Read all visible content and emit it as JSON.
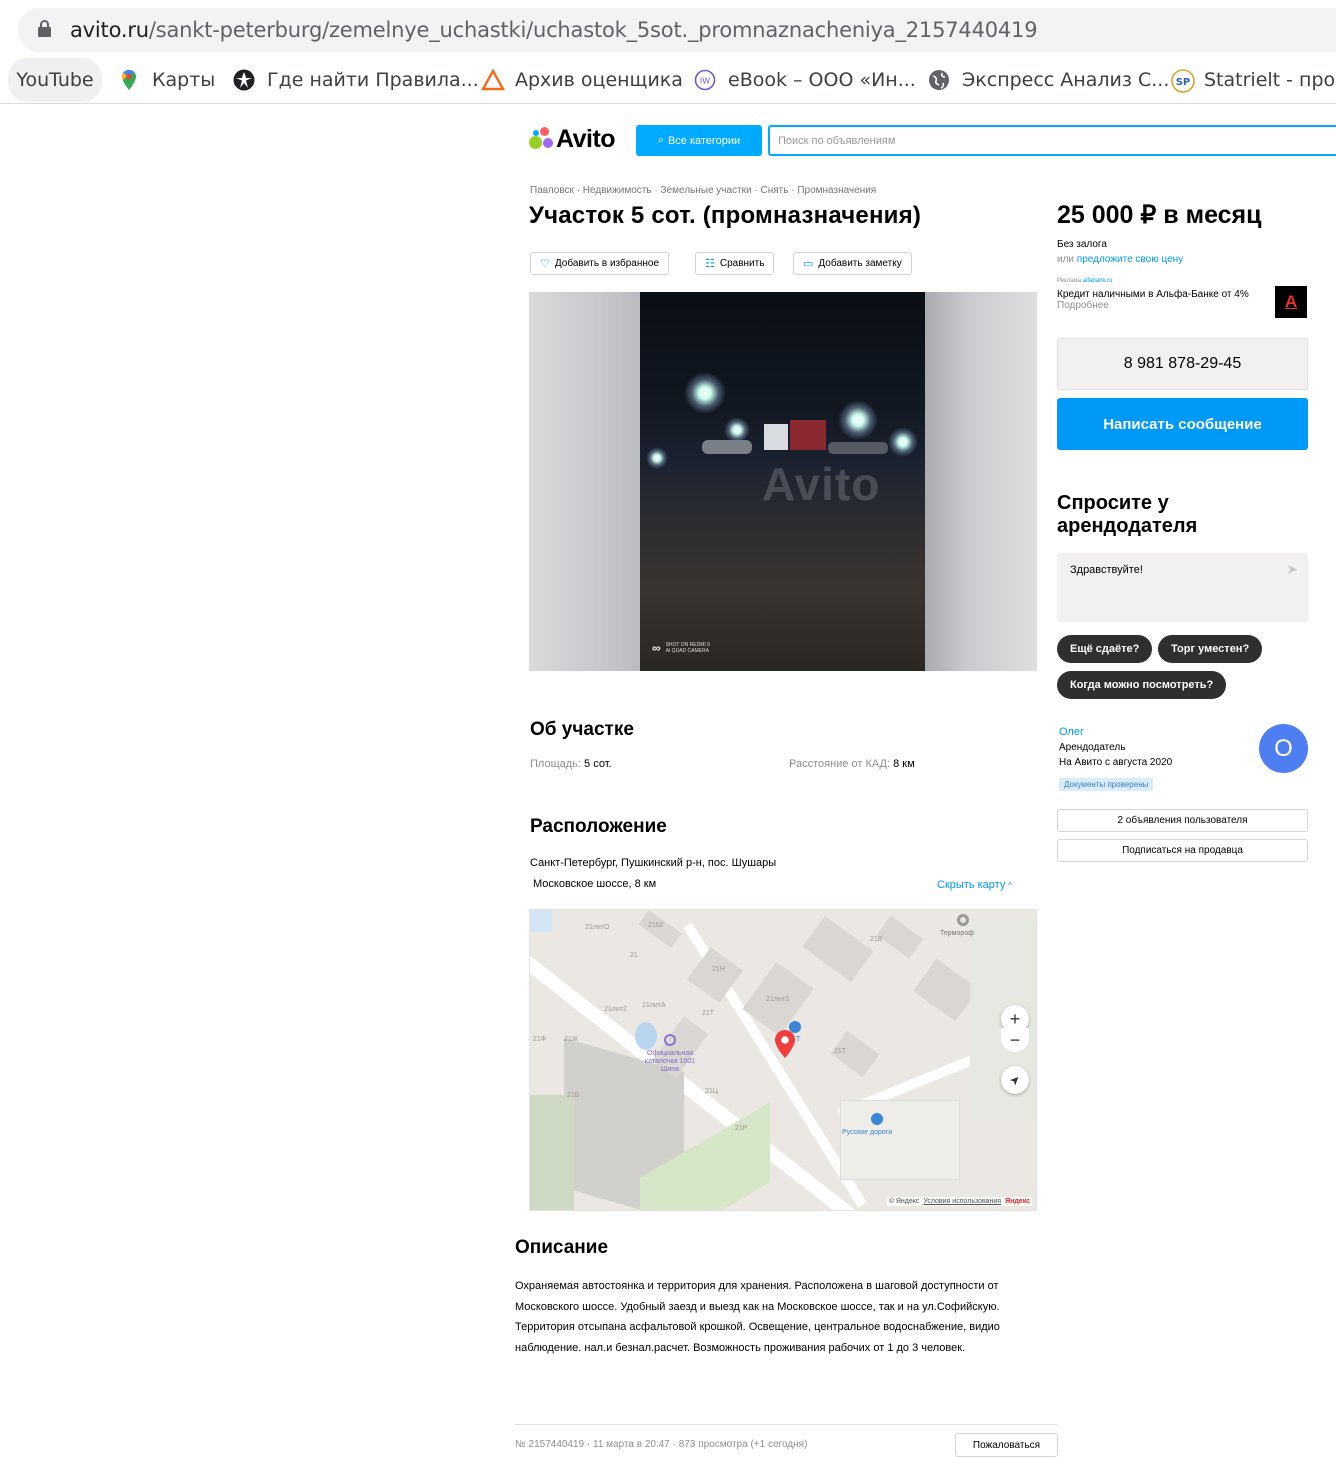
{
  "browser": {
    "url_host": "avito.ru",
    "url_path": "/sankt-peterburg/zemelnye_uchastki/uchastok_5sot._promnaznacheniya_2157440419",
    "bookmarks": [
      {
        "label": "YouTube",
        "icon": "youtube-icon"
      },
      {
        "label": "Карты",
        "icon": "maps-pin-icon"
      },
      {
        "label": "Где найти Правила...",
        "icon": "compass-icon"
      },
      {
        "label": "Архив оценщика",
        "icon": "triangle-icon"
      },
      {
        "label": "eBook – ООО «Ин...",
        "icon": "ebook-icon"
      },
      {
        "label": "Экспресс Анализ С...",
        "icon": "globe-icon"
      },
      {
        "label": "Statrielt - прод",
        "icon": "statrielt-icon"
      }
    ]
  },
  "header": {
    "logo": "Avito",
    "categories_button": "Все категории",
    "search_placeholder": "Поиск по объявлениям"
  },
  "listing": {
    "breadcrumbs": "Павловск · Недвижимость · Земельные участки · Снять · Промназначения",
    "title": "Участок 5 сот. (промназначения)",
    "actions": {
      "favorite": "Добавить в избранное",
      "compare": "Сравнить",
      "note": "Добавить заметку"
    },
    "photo": {
      "watermark": "Avito",
      "camera_line1": "SHOT ON REDMI 9",
      "camera_line2": "AI QUAD CAMERA"
    },
    "about": {
      "heading": "Об участке",
      "area_label": "Площадь:",
      "area_value": "5 сот.",
      "distance_label": "Расстояние от КАД:",
      "distance_value": "8 км"
    },
    "location": {
      "heading": "Расположение",
      "address": "Санкт-Петербург, Пушкинский р-н, пос. Шушары",
      "road": "Московское шоссе, 8 км",
      "hide_map": "Скрыть карту",
      "map_labels": [
        "21литО",
        "2102",
        "21",
        "21Н",
        "21Т",
        "21литА",
        "21лит3",
        "21лит2",
        "21Ж",
        "21Б",
        "21В",
        "21Т",
        "21Ц",
        "21Р",
        "21Ф"
      ],
      "map_pois": {
        "termorof": "Термороф",
        "katok": "Официальная каталочка 1001 Шина",
        "roads": "Русские дороги",
        "poi_t": "Т"
      },
      "map_copyright": "© Яндекс",
      "map_terms": "Условия использования",
      "map_brand": "Яндекс"
    },
    "description": {
      "heading": "Описание",
      "text": "Охраняемая автостоянка и территория для хранения. Расположена в шаговой доступности от Московского шоссе. Удобный заезд и выезд как на Московское шоссе, так и на ул.Софийскую. Территория отсыпана асфальтовой крошкой. Освещение, центральное водоснабжение, видио наблюдение. нал.и безнал.расчет. Возможность проживания рабочих от 1 до 3 человек."
    },
    "footer": {
      "meta": "№ 2157440419 · 11 марта в 20:47 · 873 просмотра (+1 сегодня)",
      "report": "Пожаловаться"
    }
  },
  "sidebar": {
    "price": "25 000 ₽ в месяц",
    "deposit": "Без залога",
    "offer_prefix": "или",
    "offer_link": "предложите свою цену",
    "ad_label": "Реклама",
    "ad_domain": "alfabank.ru",
    "ad_text": "Кредит наличными в Альфа-Банке от 4%",
    "ad_more": "Подробнее",
    "ad_logo": "А",
    "phone": "8 981 878-29-45",
    "message_button": "Написать сообщение",
    "ask_heading": "Спросите у арендодателя",
    "chat_text": "Здравствуйте!",
    "chips": [
      "Ещё сдаёте?",
      "Торг уместен?",
      "Когда можно посмотреть?"
    ],
    "seller": {
      "name": "Олег",
      "role": "Арендодатель",
      "since": "На Авито с августа 2020",
      "badge": "Документы проверены",
      "avatar_letter": "О",
      "listings_button": "2 объявления пользователя",
      "subscribe_button": "Подписаться на продавца"
    }
  },
  "colors": {
    "accent": "#00aaff",
    "button_blue": "#0099f7",
    "link": "#0099f7",
    "avatar": "#4d7ef2",
    "chip": "#2f2f2f",
    "alfa_red": "#ef3124"
  }
}
